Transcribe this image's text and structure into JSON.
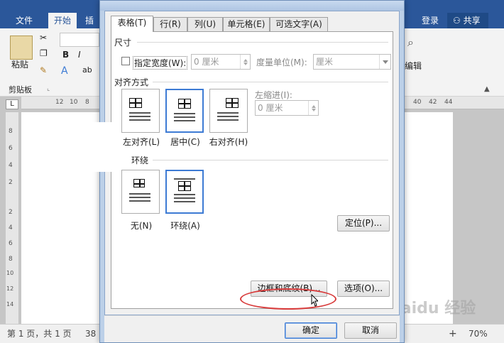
{
  "ribbon": {
    "tabs": [
      "文件",
      "开始",
      "插"
    ],
    "login": "登录",
    "share": "共享",
    "groups": {
      "paste": "粘贴",
      "clipboard": "剪贴板",
      "edit": "编辑"
    },
    "format_b": "B",
    "format_i": "I"
  },
  "ruler": {
    "top_numbers": [
      "12",
      "10",
      "8",
      "40",
      "42",
      "44"
    ],
    "left_numbers": [
      "8",
      "6",
      "4",
      "2",
      "2",
      "4",
      "6",
      "8",
      "10",
      "12",
      "14"
    ]
  },
  "status": {
    "page": "第 1 页，共 1 页",
    "words": "38",
    "zoom": "70%",
    "zoom_plus": "+"
  },
  "dialog": {
    "tabs": [
      "表格(T)",
      "行(R)",
      "列(U)",
      "单元格(E)",
      "可选文字(A)"
    ],
    "size_section": "尺寸",
    "specify_width_label": "指定宽度(W):",
    "width_value": "0 厘米",
    "unit_label": "度量单位(M):",
    "unit_value": "厘米",
    "align_section": "对齐方式",
    "align_options": [
      "左对齐(L)",
      "居中(C)",
      "右对齐(H)"
    ],
    "indent_label": "左缩进(I):",
    "indent_value": "0 厘米",
    "wrap_section": "环绕",
    "wrap_options": [
      "无(N)",
      "环绕(A)"
    ],
    "position_button": "定位(P)...",
    "borders_button": "边框和底纹(B)...",
    "options_button": "选项(O)...",
    "ok_button": "确定",
    "cancel_button": "取消"
  },
  "watermark": "Baidu 经验",
  "colors": {
    "word_blue": "#2b579a",
    "selection_blue": "#3d7bd4",
    "highlight_red": "#d83b3b"
  }
}
